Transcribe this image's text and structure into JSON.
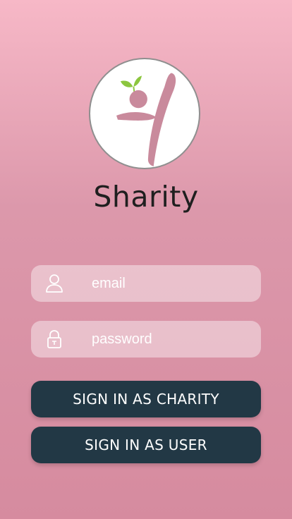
{
  "app": {
    "title": "Sharity"
  },
  "login": {
    "email_placeholder": "email",
    "password_placeholder": "password",
    "email_icon": "user-icon",
    "password_icon": "lock-icon"
  },
  "buttons": {
    "sign_in_charity": "SIGN IN AS CHARITY",
    "sign_in_user": "SIGN IN AS USER"
  },
  "colors": {
    "background_top": "#f7b8c7",
    "background_bottom": "#d68b9f",
    "button": "#223845",
    "logo_figure": "#c98a9c",
    "logo_leaf": "#8cc63f"
  }
}
